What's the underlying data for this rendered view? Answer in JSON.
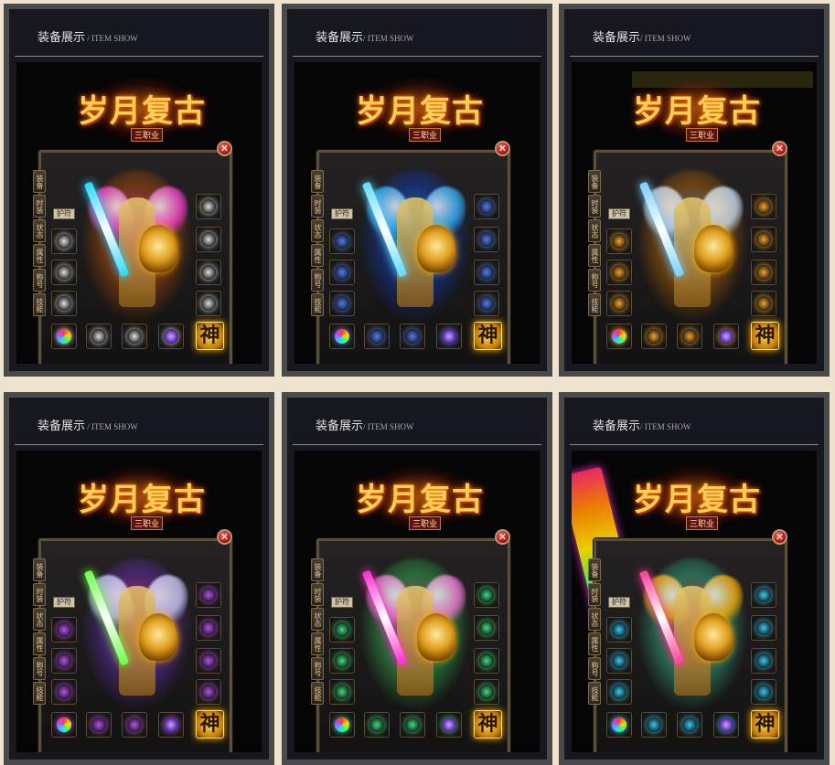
{
  "cards": [
    {
      "title_zh": "装备展示",
      "title_en": " / ITEM SHOW",
      "logo_text": "岁月复古",
      "logo_sub": "三职业",
      "close_glyph": "✕",
      "tabs": [
        "装备",
        "时装",
        "状态",
        "属性",
        "称号",
        "技能"
      ],
      "tag_label": "护符",
      "god_label": "神",
      "theme": {
        "aura": "#ff2bd0",
        "aura2": "#ff6a00",
        "sword": "#27d8ff",
        "wing": "#ff3fd8",
        "gem": "#e0e0e0"
      },
      "banner": false,
      "flag": false
    },
    {
      "title_zh": "装备展示",
      "title_en": "/ ITEM SHOW",
      "logo_text": "岁月复古",
      "logo_sub": "三职业",
      "close_glyph": "✕",
      "tabs": [
        "装备",
        "时装",
        "状态",
        "属性",
        "称号",
        "技能"
      ],
      "tag_label": "护符",
      "god_label": "神",
      "theme": {
        "aura": "#16a9ff",
        "aura2": "#0a4dff",
        "sword": "#5fdcff",
        "wing": "#2fb4ff",
        "gem": "#4b7dff"
      },
      "banner": false,
      "flag": false
    },
    {
      "title_zh": "装备展示",
      "title_en": "/ ITEM SHOW",
      "logo_text": "岁月复古",
      "logo_sub": "三职业",
      "close_glyph": "✕",
      "tabs": [
        "装备",
        "时装",
        "状态",
        "属性",
        "称号",
        "技能"
      ],
      "tag_label": "护符",
      "god_label": "神",
      "theme": {
        "aura": "#3da0ff",
        "aura2": "#ff8a00",
        "sword": "#7ad0ff",
        "wing": "#cfe6ff",
        "gem": "#ffa21c"
      },
      "banner": true,
      "flag": false
    },
    {
      "title_zh": "装备展示",
      "title_en": " / ITEM SHOW",
      "logo_text": "岁月复古",
      "logo_sub": "三职业",
      "close_glyph": "✕",
      "tabs": [
        "装备",
        "时装",
        "状态",
        "属性",
        "称号",
        "技能"
      ],
      "tag_label": "护符",
      "god_label": "神",
      "theme": {
        "aura": "#ff2b6b",
        "aura2": "#8a3bff",
        "sword": "#6aff4a",
        "wing": "#d0d0ff",
        "gem": "#c04aff"
      },
      "banner": false,
      "flag": false
    },
    {
      "title_zh": "装备展示",
      "title_en": "/ ITEM SHOW",
      "logo_text": "岁月复古",
      "logo_sub": "三职业",
      "close_glyph": "✕",
      "tabs": [
        "装备",
        "时装",
        "状态",
        "属性",
        "称号",
        "技能"
      ],
      "tag_label": "护符",
      "god_label": "神",
      "theme": {
        "aura": "#ff3fb0",
        "aura2": "#3aff6a",
        "sword": "#ff2bd0",
        "wing": "#ff7ae0",
        "gem": "#33e37a"
      },
      "banner": false,
      "flag": false
    },
    {
      "title_zh": "装备展示",
      "title_en": "/ ITEM SHOW",
      "logo_text": "岁月复古",
      "logo_sub": "三职业",
      "close_glyph": "✕",
      "tabs": [
        "装备",
        "时装",
        "状态",
        "属性",
        "称号",
        "技能"
      ],
      "tag_label": "护符",
      "god_label": "神",
      "theme": {
        "aura": "#ff3a3a",
        "aura2": "#3affc0",
        "sword": "#ff3a9a",
        "wing": "#ffb000",
        "gem": "#29d0ff"
      },
      "banner": false,
      "flag": true
    }
  ]
}
